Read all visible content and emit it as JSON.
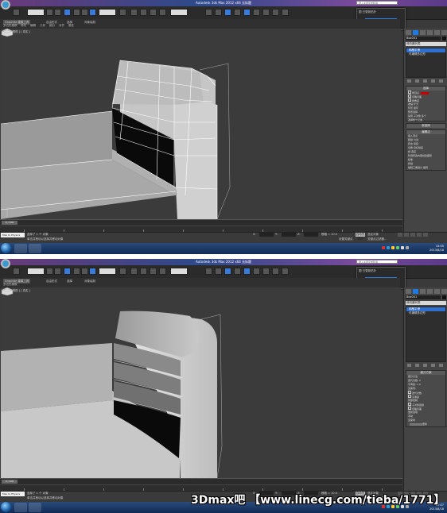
{
  "screenshots": [
    {
      "id": "before",
      "window_title": "Autodesk 3ds Max 2012 x64   无标题",
      "search_placeholder": "键入关键字或短语",
      "popup": {
        "title": "图  已更新拓扑",
        "button_label": "已应用以上"
      },
      "ribbon": {
        "tabs": [
          "Graphite 建模工具",
          "自由形式",
          "选择",
          "对象绘制"
        ],
        "panel_labels": [
          "多边形建模",
          "修改",
          "编辑",
          "几何",
          "细分",
          "对齐",
          "属性"
        ]
      },
      "viewport_label": "[ + ] [ 透视 ] [ 真实 ]",
      "command_panel": {
        "object_name": "Box001",
        "modifier_list": "修改器列表",
        "stack_items": [
          {
            "label": "网格平滑",
            "selected": true
          },
          {
            "label": "可编辑多边形",
            "selected": false
          }
        ],
        "rollouts": [
          {
            "title": "选择",
            "rows": [
              "按顶点",
              "忽略背面",
              "按角度",
              "收缩  扩大",
              "环形  循环",
              "预览选择",
              "禁用  子对象  多个",
              "选择整个元素"
            ]
          },
          {
            "title": "软选择",
            "rows": []
          },
          {
            "title": "编辑边",
            "rows": [
              "插入顶点",
              "移除  分割",
              "挤出  焊接",
              "切角  目标焊接",
              "桥  连接",
              "利用所选内容创建图形",
              "权重",
              "拆缝",
              "编辑三角剖分  旋转"
            ]
          }
        ]
      },
      "timeline": {
        "position": "0 / 100"
      },
      "status": {
        "selection": "选择了 1 个 对象",
        "prompt": "单击并拖动以选择并移动对象",
        "grid": "栅格 = 10.0",
        "x_label": "X:",
        "y_label": "Y:",
        "z_label": "Z:",
        "autokey": "自动关键点",
        "selected_label": "选定对象",
        "setkey": "设置关键点",
        "filter": "关键点过滤器..."
      },
      "taskbar": {
        "start_label": "Max to Physics",
        "time": "15:05",
        "date": "2013/8/18"
      }
    },
    {
      "id": "after",
      "window_title": "Autodesk 3ds Max 2012 x64   无标题",
      "search_placeholder": "键入关键字或短语",
      "popup": {
        "title": "图  已更新拓扑",
        "button_label": "已应用以上"
      },
      "ribbon": {
        "tabs": [
          "Graphite 建模工具",
          "自由形式",
          "选择",
          "对象绘制"
        ],
        "panel_labels": [
          "多边形建模"
        ]
      },
      "viewport_label": "[ + ] [ 透视 ] [ 真实 ]",
      "command_panel": {
        "object_name": "Box001",
        "modifier_list": "修改器列表",
        "stack_items": [
          {
            "label": "网格平滑",
            "selected": true
          },
          {
            "label": "可编辑多边形",
            "selected": false
          }
        ],
        "rollouts": [
          {
            "title": "细分方案",
            "rows": [
              "细分方法:",
              "迭代次数: 2",
              "平滑度: 1.0",
              "渲染值:",
              "迭代次数",
              "平滑度",
              "局部控制",
              "子对象层级",
              "忽略背面",
              "更新选项",
              "手动",
              "渲染时",
              "更新"
            ]
          }
        ]
      },
      "timeline": {
        "position": "0 / 100"
      },
      "status": {
        "selection": "选择了 1 个 对象",
        "prompt": "单击并拖动以选择并移动对象",
        "grid": "栅格 = 10.0",
        "x_label": "X:",
        "y_label": "Y:",
        "z_label": "Z:",
        "autokey": "自动关键点",
        "selected_label": "选定对象",
        "setkey": "设置关键点",
        "filter": "关键点过滤器..."
      },
      "taskbar": {
        "start_label": "Max to Physics",
        "time": "15:07",
        "date": "2013/8/18"
      }
    }
  ],
  "watermark": "3Dmax吧 【www.linecg.com/tieba/1771】",
  "colors": {
    "accent": "#2f6fd0",
    "viewport_bg": "#3b3b3b",
    "panel_bg": "#444444",
    "red_box": "#cc0000"
  }
}
